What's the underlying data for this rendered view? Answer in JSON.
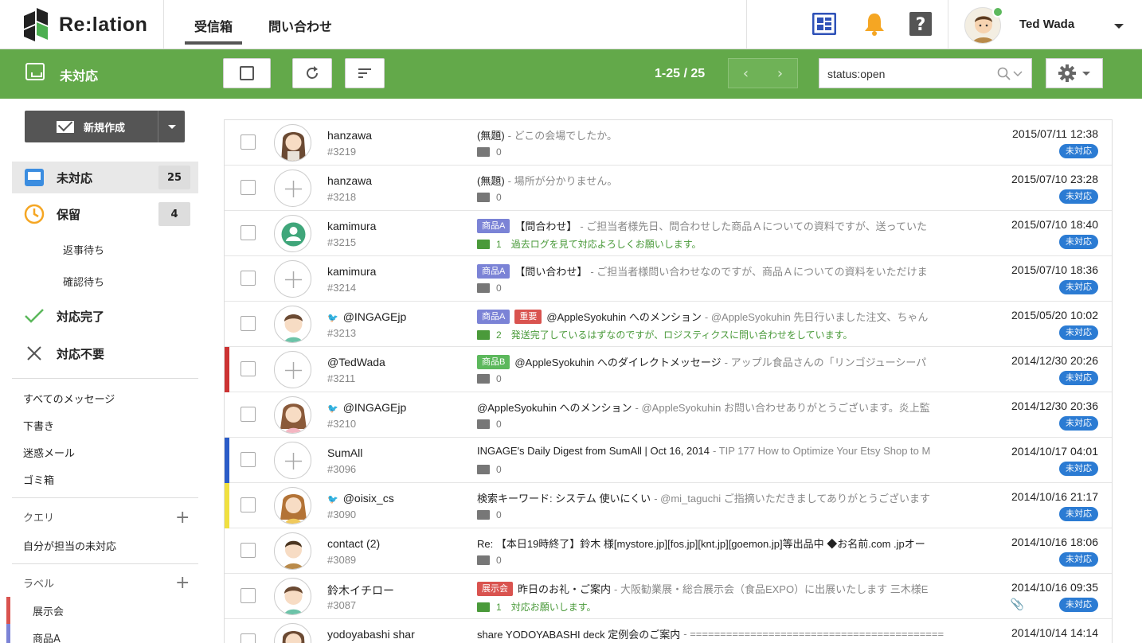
{
  "app": {
    "name": "Re:lation"
  },
  "topnav": {
    "tabs": [
      "受信箱",
      "問い合わせ"
    ]
  },
  "user": {
    "name": "Ted Wada"
  },
  "toolbar": {
    "title": "未対応",
    "pager": "1-25 / 25",
    "search_value": "status:open"
  },
  "sidebar": {
    "compose": "新規作成",
    "primary": [
      {
        "label": "未対応",
        "count": "25"
      },
      {
        "label": "保留",
        "count": "4"
      }
    ],
    "sub": [
      "返事待ち",
      "確認待ち"
    ],
    "done": "対応完了",
    "unneeded": "対応不要",
    "links": [
      "すべてのメッセージ",
      "下書き",
      "迷惑メール",
      "ゴミ箱"
    ],
    "query_head": "クエリ",
    "query_items": [
      "自分が担当の未対応"
    ],
    "label_head": "ラベル",
    "labels": [
      {
        "name": "展示会",
        "color": "#d9534f"
      },
      {
        "name": "商品A",
        "color": "#7b83d6"
      }
    ]
  },
  "messages": [
    {
      "name": "hanzawa",
      "twitter": false,
      "id": "#3219",
      "tags": [],
      "subject": "(無題)",
      "preview": "- どこの会場でしたか。",
      "comments": "0",
      "comment_text": "",
      "date": "2015/07/11 12:38",
      "status": "未対応",
      "stripe": "",
      "avatar": "girl"
    },
    {
      "name": "hanzawa",
      "twitter": false,
      "id": "#3218",
      "tags": [],
      "subject": "(無題)",
      "preview": "- 場所が分かりません。",
      "comments": "0",
      "comment_text": "",
      "date": "2015/07/10 23:28",
      "status": "未対応",
      "stripe": "",
      "avatar": "plus"
    },
    {
      "name": "kamimura",
      "twitter": false,
      "id": "#3215",
      "tags": [
        {
          "text": "商品A",
          "color": "#7b83d6"
        }
      ],
      "subject": "【問合わせ】",
      "preview": "- ご担当者様先日、問合わせした商品Ａについての資料ですが、送っていた",
      "comments": "1",
      "comment_text": "過去ログを見て対応よろしくお願いします。",
      "date": "2015/07/10 18:40",
      "status": "未対応",
      "stripe": "",
      "avatar": "person"
    },
    {
      "name": "kamimura",
      "twitter": false,
      "id": "#3214",
      "tags": [
        {
          "text": "商品A",
          "color": "#7b83d6"
        }
      ],
      "subject": "【問い合わせ】",
      "preview": "- ご担当者様問い合わせなのですが、商品Ａについての資料をいただけま",
      "comments": "0",
      "comment_text": "",
      "date": "2015/07/10 18:36",
      "status": "未対応",
      "stripe": "",
      "avatar": "plus"
    },
    {
      "name": "@INGAGEjp",
      "twitter": true,
      "id": "#3213",
      "tags": [
        {
          "text": "商品A",
          "color": "#7b83d6"
        },
        {
          "text": "重要",
          "color": "#d9534f"
        }
      ],
      "subject": "@AppleSyokuhin へのメンション",
      "preview": "- @AppleSyokuhin 先日行いました注文、ちゃん",
      "comments": "2",
      "comment_text": "発送完了しているはずなのですが、ロジスティクスに問い合わせをしています。",
      "date": "2015/05/20 10:02",
      "status": "未対応",
      "stripe": "",
      "avatar": "boy"
    },
    {
      "name": "@TedWada",
      "twitter": false,
      "id": "#3211",
      "tags": [
        {
          "text": "商品B",
          "color": "#5cb85c"
        }
      ],
      "subject": "@AppleSyokuhin へのダイレクトメッセージ",
      "preview": "- アップル食品さんの「リンゴジューシーパ",
      "comments": "0",
      "comment_text": "",
      "date": "2014/12/30 20:26",
      "status": "未対応",
      "stripe": "#cc3333",
      "avatar": "plus"
    },
    {
      "name": "@INGAGEjp",
      "twitter": true,
      "id": "#3210",
      "tags": [],
      "subject": "@AppleSyokuhin へのメンション",
      "preview": "- @AppleSyokuhin お問い合わせありがとうございます。炎上監",
      "comments": "0",
      "comment_text": "",
      "date": "2014/12/30 20:36",
      "status": "未対応",
      "stripe": "",
      "avatar": "girl2"
    },
    {
      "name": "SumAll",
      "twitter": false,
      "id": "#3096",
      "tags": [],
      "subject": "INGAGE's Daily Digest from SumAll | Oct 16, 2014",
      "preview": "- TIP 177 How to Optimize Your Etsy Shop to M",
      "comments": "0",
      "comment_text": "",
      "date": "2014/10/17 04:01",
      "status": "未対応",
      "stripe": "#2b5cc8",
      "avatar": "plus"
    },
    {
      "name": "@oisix_cs",
      "twitter": true,
      "id": "#3090",
      "tags": [],
      "subject": "検索キーワード: システム 使いにくい",
      "preview": "- @mi_taguchi ご指摘いただきましてありがとうございます",
      "comments": "0",
      "comment_text": "",
      "date": "2014/10/16 21:17",
      "status": "未対応",
      "stripe": "#f0e040",
      "avatar": "girl3"
    },
    {
      "name": "contact (2)",
      "twitter": false,
      "id": "#3089",
      "tags": [],
      "subject": "Re: 【本日19時終了】鈴木 様[mystore.jp][fos.jp][knt.jp][goemon.jp]等出品中 ◆お名前.com .jpオー",
      "preview": "",
      "comments": "0",
      "comment_text": "",
      "date": "2014/10/16 18:06",
      "status": "未対応",
      "stripe": "",
      "avatar": "man"
    },
    {
      "name": "鈴木イチロー",
      "twitter": false,
      "id": "#3087",
      "tags": [
        {
          "text": "展示会",
          "color": "#d9534f"
        }
      ],
      "subject": "昨日のお礼・ご案内",
      "preview": "- 大阪勧業展・総合展示会（食品EXPO）に出展いたします 三木様E",
      "comments": "1",
      "comment_text": "対応お願いします。",
      "date": "2014/10/16 09:35",
      "status": "未対応",
      "stripe": "",
      "avatar": "boy",
      "clip": true
    },
    {
      "name": "yodoyabashi shar",
      "twitter": false,
      "id": "",
      "tags": [],
      "subject": "share YODOYABASHI deck 定例会のご案内",
      "preview": "- ==========================================",
      "comments": "",
      "comment_text": "",
      "date": "2014/10/14 14:14",
      "status": "",
      "stripe": "",
      "avatar": "girl"
    }
  ],
  "colors": {
    "brand_green": "#63a94a",
    "status_blue": "#2b7bd3",
    "comment_green": "#4a9a3a"
  },
  "icons": [
    "grid-icon",
    "bell-icon",
    "help-icon",
    "refresh-icon",
    "sort-icon",
    "search-icon",
    "gear-icon",
    "clock-icon",
    "check-icon",
    "cross-icon",
    "plus-icon",
    "twitter-icon",
    "comment-icon",
    "paperclip-icon"
  ]
}
